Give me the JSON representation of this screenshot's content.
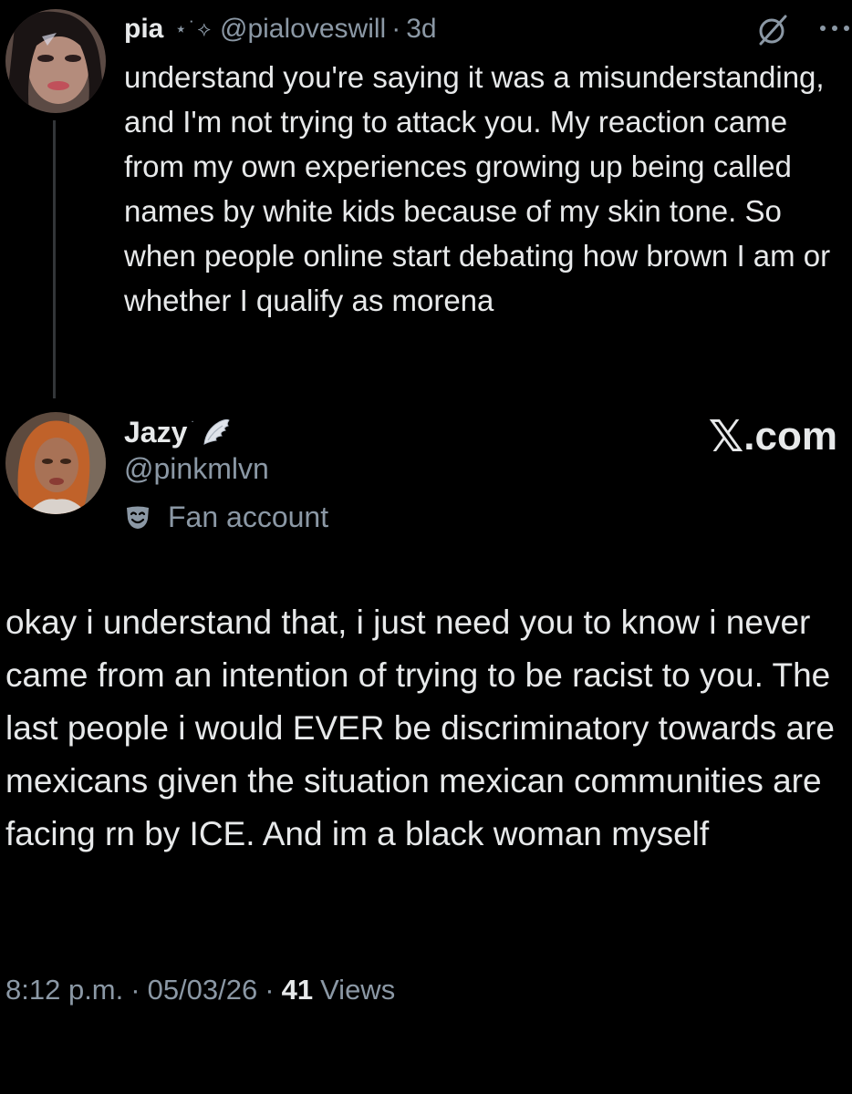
{
  "colors": {
    "background": "#000000",
    "text_primary": "#e7e9ea",
    "text_secondary": "#8b98a5",
    "thread_line": "#333639"
  },
  "parent_post": {
    "display_name": "pia",
    "name_decoration": "⋆˙⟡",
    "handle": "@pialoveswill",
    "separator": "·",
    "age": "3d",
    "icons": [
      "grok-icon",
      "more-options-icon"
    ],
    "text": "understand you're saying it was a misunderstanding, and I'm not trying to attack you. My reaction came from my own experiences growing up being called names by white kids because of my skin tone. So when people online start debating how brown I am or whether I qualify as morena"
  },
  "main_post": {
    "display_name": "Jazy",
    "name_decoration": "˙",
    "badge_icon": "angel-wing-icon",
    "handle": "@pinkmlvn",
    "account_label": "Fan account",
    "account_label_icon": "mask-icon",
    "text": "okay i understand that, i just need you to know i never came from an intention of trying to be racist to you. The last people i would EVER be discriminatory towards are mexicans given the situation mexican communities are facing rn by ICE. And im a black woman myself",
    "time": "8:12 p.m.",
    "date": "05/03/26",
    "separator": "·",
    "views_count": "41",
    "views_label": "Views"
  },
  "watermark": {
    "logo_letter": "𝕏",
    "text": ".com"
  }
}
